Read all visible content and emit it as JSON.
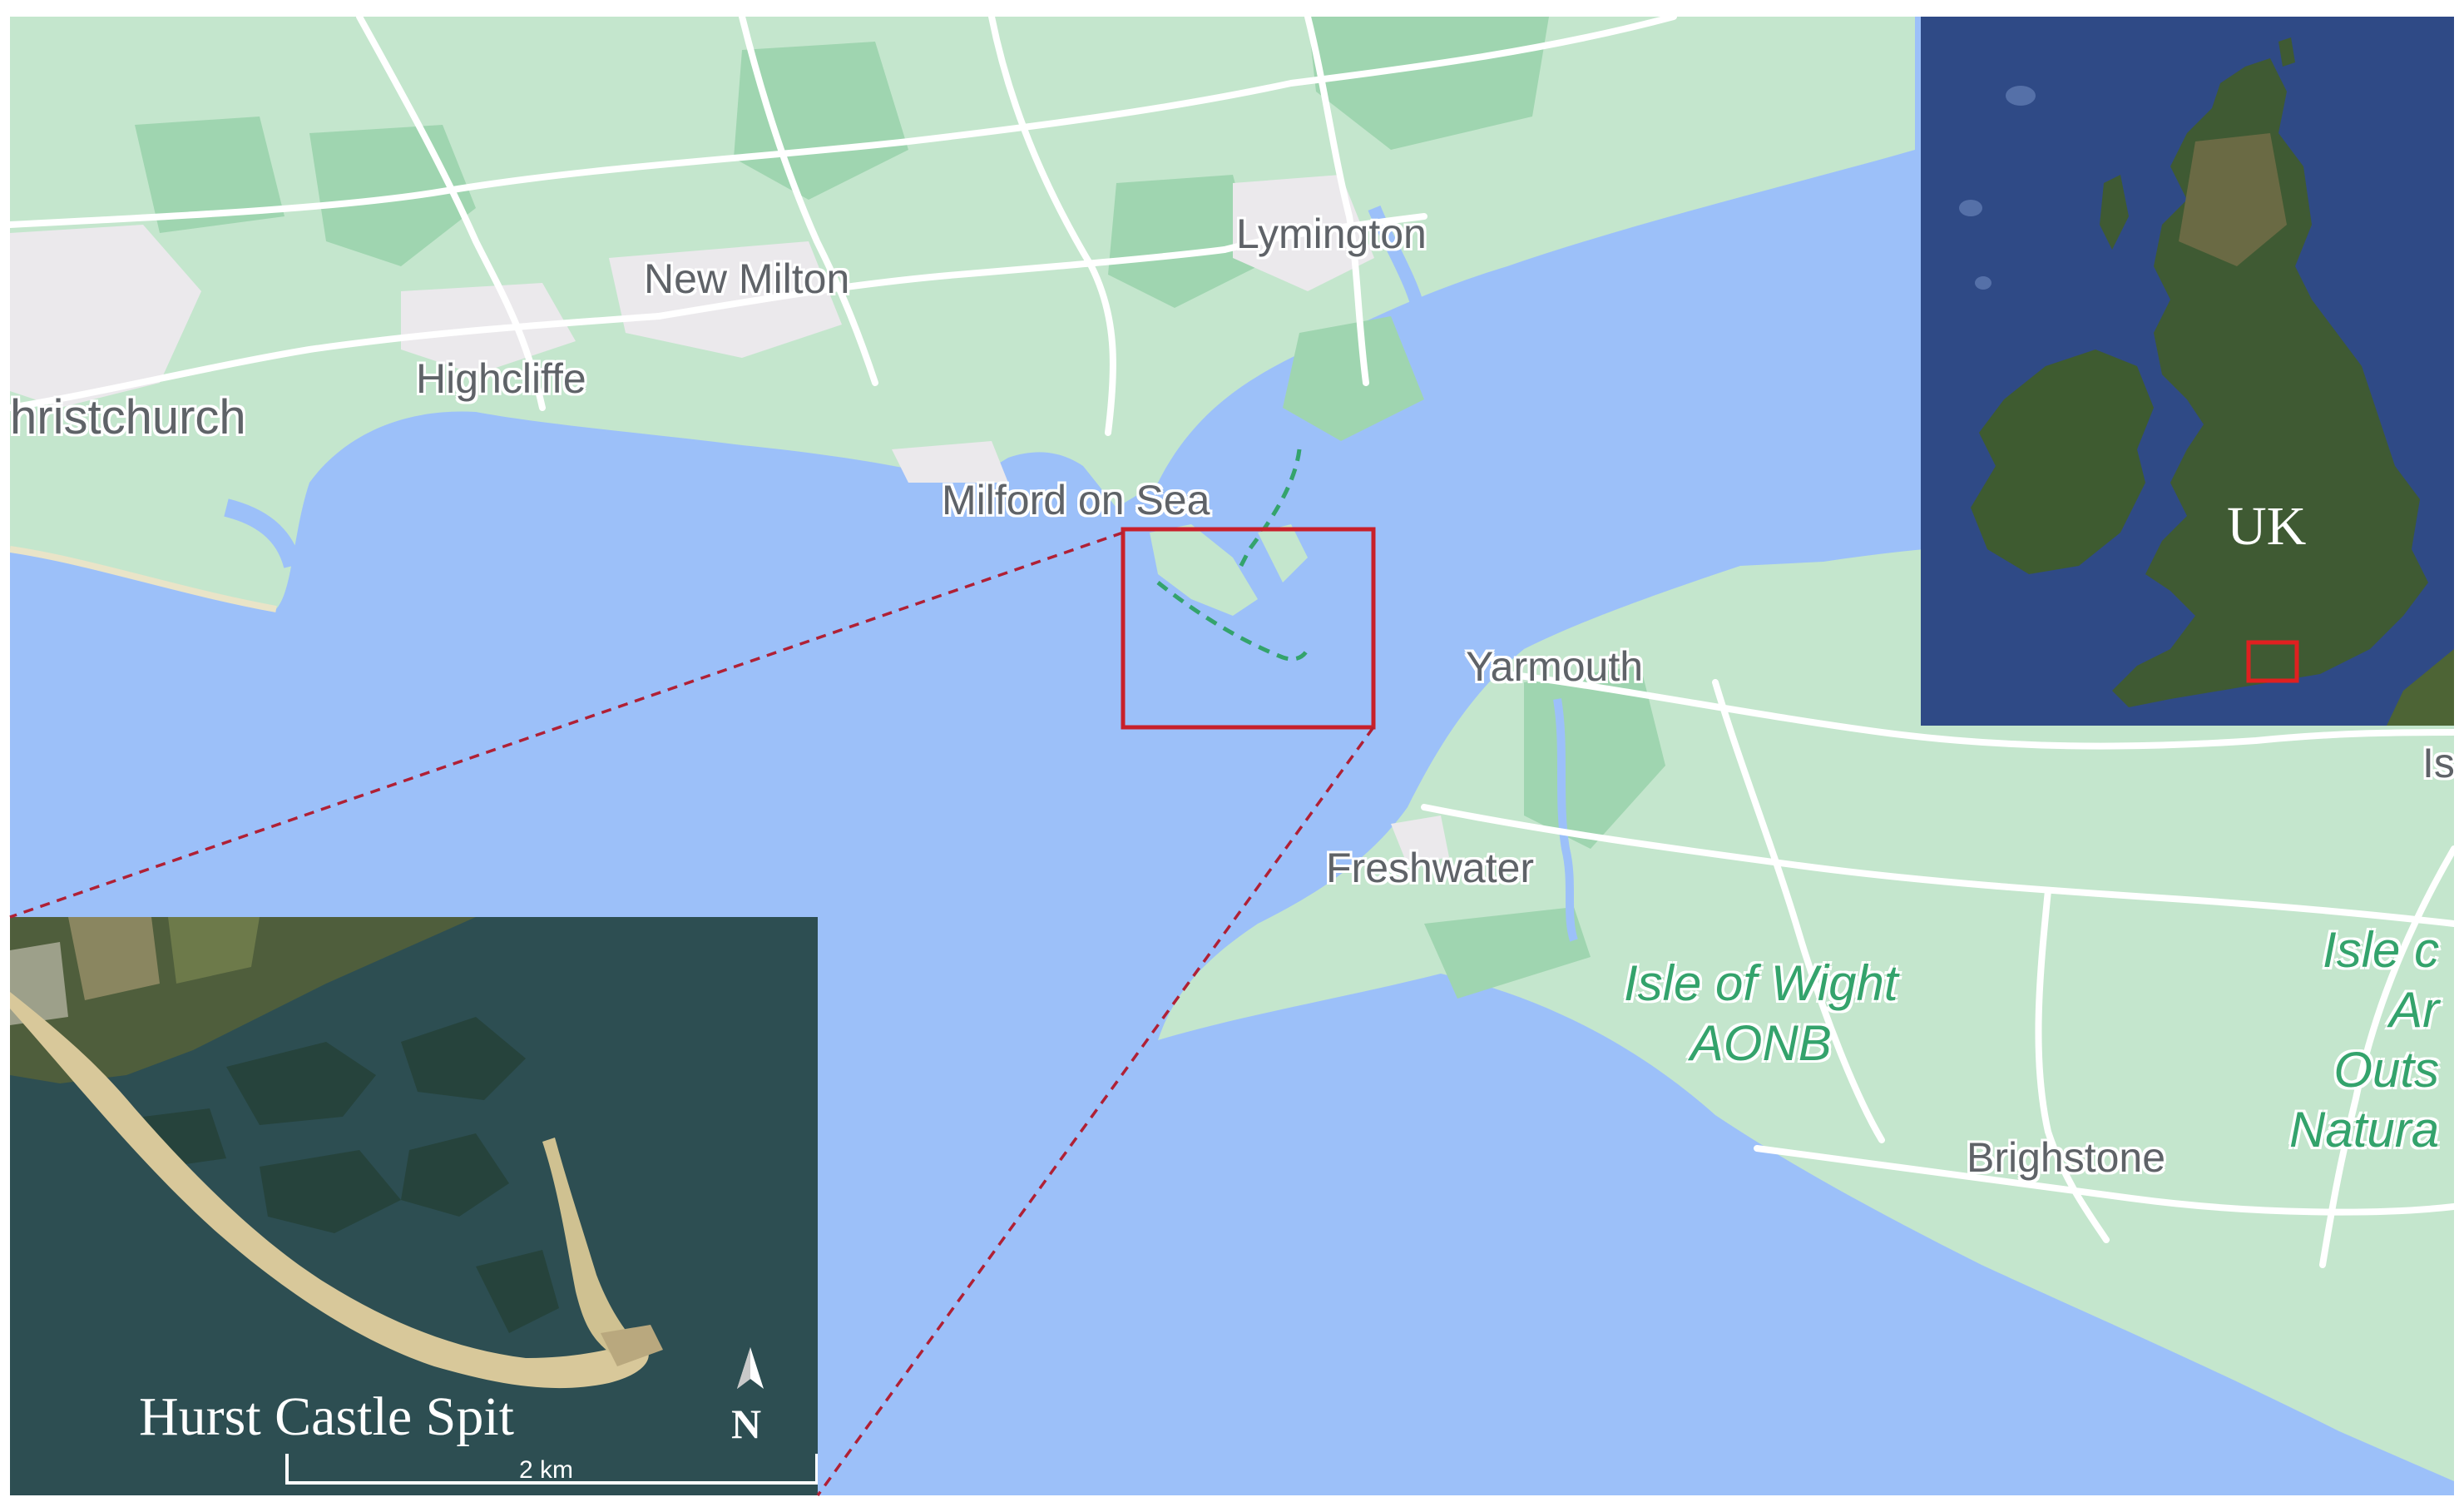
{
  "places": {
    "christchurch": "hristchurch",
    "highcliffe": "Highcliffe",
    "new_milton": "New Milton",
    "lymington": "Lymington",
    "milford_on_sea": "Milford on Sea",
    "yarmouth": "Yarmouth",
    "freshwater": "Freshwater",
    "brighstone": "Brighstone",
    "edge_fragment": "Is"
  },
  "protected_areas": {
    "aonb_line1": "Isle of Wight",
    "aonb_line2": "AONB",
    "edge_line1": "Isle c",
    "edge_line2": "Ar",
    "edge_line3": "Outs",
    "edge_line4": "Natura"
  },
  "uk_inset": {
    "label": "UK",
    "highlight_color": "#e02020"
  },
  "spit_inset": {
    "title": "Hurst Castle Spit",
    "north_label": "N",
    "scale_label": "2 km"
  },
  "colors": {
    "sea": "#9cc0f9",
    "land": "#c4e6cd",
    "woodland": "#9fd5b0",
    "urban": "#ebe9ec",
    "road": "#ffffff",
    "label": "#5f6368",
    "park_label": "#34a36c",
    "focus_box": "#c8202a",
    "connector": "#b02035",
    "satellite_sea": "#2d4e52"
  }
}
